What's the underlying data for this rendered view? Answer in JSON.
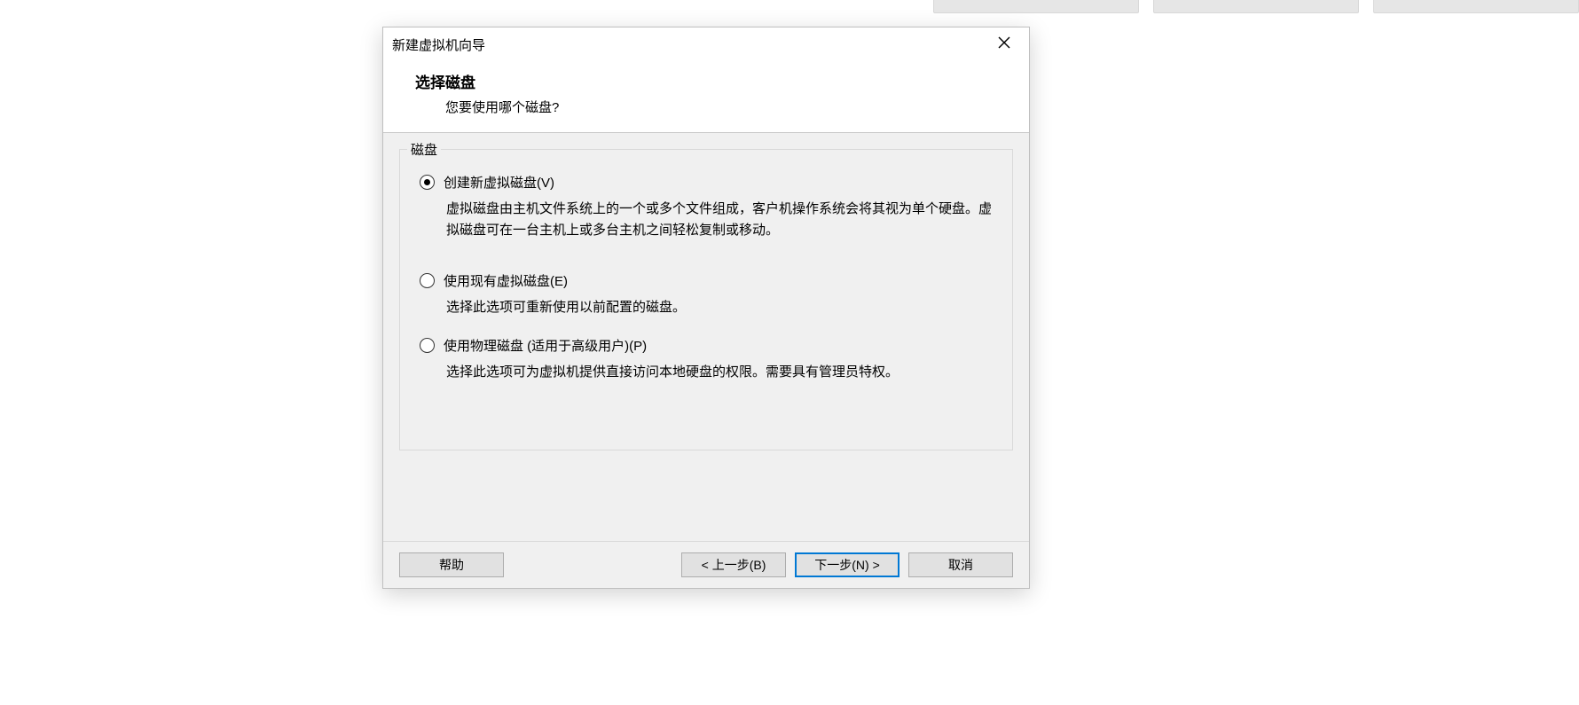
{
  "dialog": {
    "title": "新建虚拟机向导",
    "header_title": "选择磁盘",
    "header_subtitle": "您要使用哪个磁盘?",
    "group_legend": "磁盘",
    "options": [
      {
        "label": "创建新虚拟磁盘(V)",
        "description": "虚拟磁盘由主机文件系统上的一个或多个文件组成，客户机操作系统会将其视为单个硬盘。虚拟磁盘可在一台主机上或多台主机之间轻松复制或移动。",
        "checked": true
      },
      {
        "label": "使用现有虚拟磁盘(E)",
        "description": "选择此选项可重新使用以前配置的磁盘。",
        "checked": false
      },
      {
        "label": "使用物理磁盘 (适用于高级用户)(P)",
        "description": "选择此选项可为虚拟机提供直接访问本地硬盘的权限。需要具有管理员特权。",
        "checked": false
      }
    ],
    "buttons": {
      "help": "帮助",
      "back": "< 上一步(B)",
      "next": "下一步(N) >",
      "cancel": "取消"
    }
  }
}
